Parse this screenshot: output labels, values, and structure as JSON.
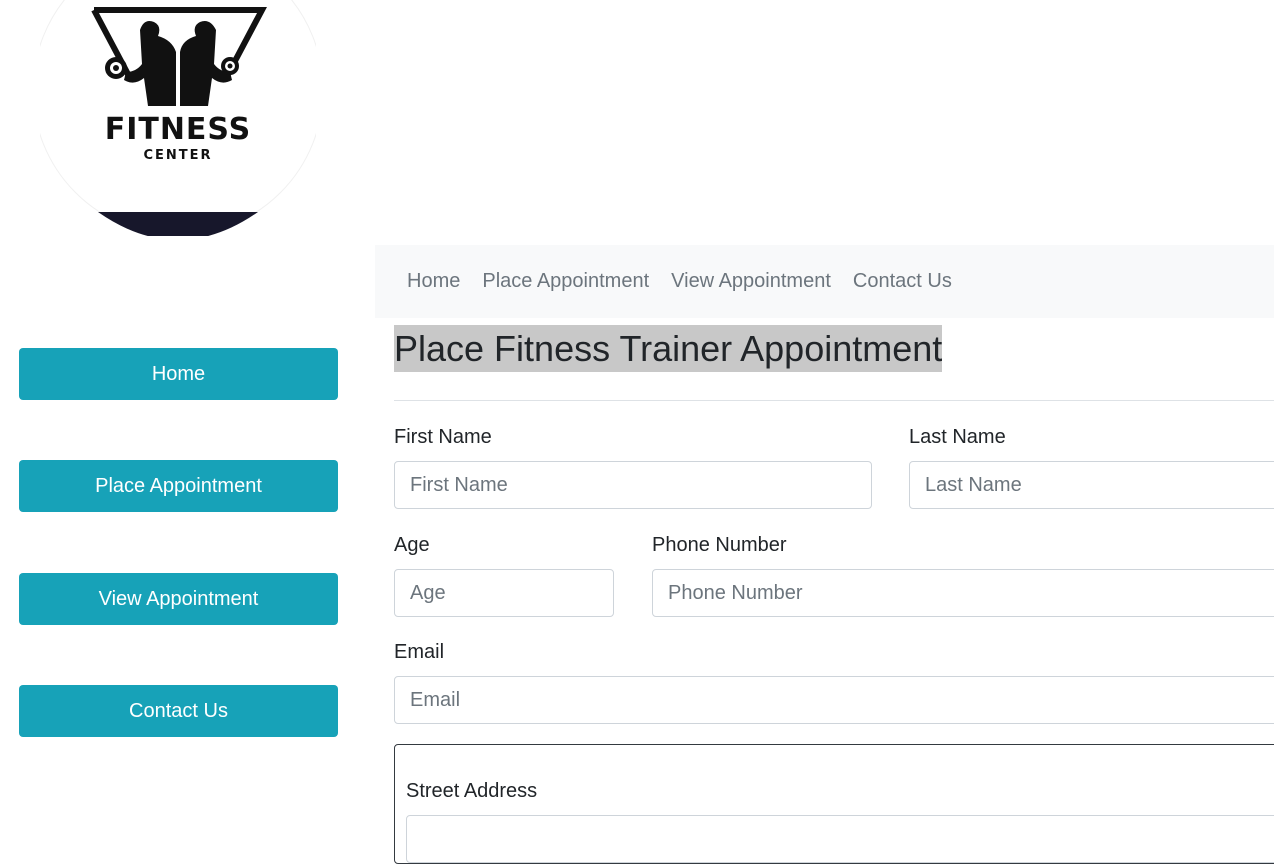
{
  "logo": {
    "title": "FITNESS",
    "subtitle": "CENTER"
  },
  "sidebar": {
    "buttons": [
      {
        "label": "Home"
      },
      {
        "label": "Place Appointment"
      },
      {
        "label": "View Appointment"
      },
      {
        "label": "Contact Us"
      }
    ],
    "button_color": "#17a2b8"
  },
  "topnav": {
    "links": [
      {
        "label": "Home"
      },
      {
        "label": "Place Appointment"
      },
      {
        "label": "View Appointment"
      },
      {
        "label": "Contact Us"
      }
    ]
  },
  "form": {
    "title": "Place Fitness Trainer Appointment",
    "first_name": {
      "label": "First Name",
      "placeholder": "First Name"
    },
    "last_name": {
      "label": "Last Name",
      "placeholder": "Last Name"
    },
    "age": {
      "label": "Age",
      "placeholder": "Age"
    },
    "phone": {
      "label": "Phone Number",
      "placeholder": "Phone Number"
    },
    "email": {
      "label": "Email",
      "placeholder": "Email"
    },
    "street": {
      "label": "Street Address"
    }
  }
}
